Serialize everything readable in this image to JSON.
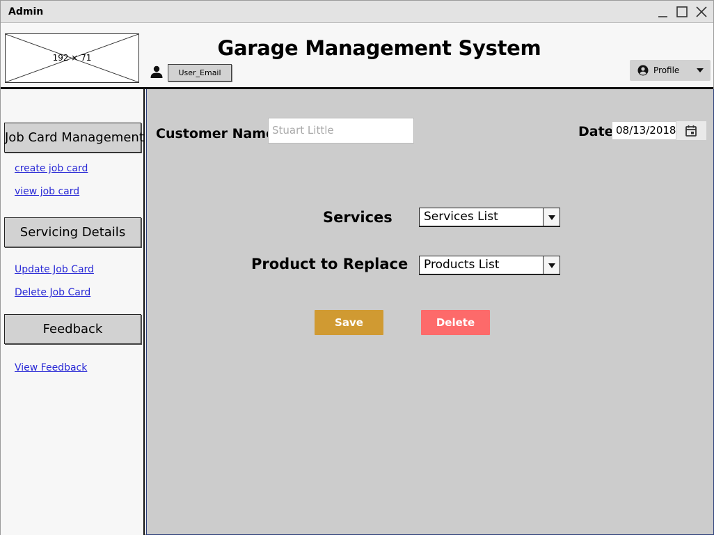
{
  "window": {
    "title": "Admin"
  },
  "header": {
    "logo_placeholder": "192 × 71",
    "app_title": "Garage Management System",
    "user_email": "User_Email",
    "profile_label": "Profile"
  },
  "sidebar": {
    "sections": [
      {
        "label": "Job Card Management",
        "links": [
          "create job card",
          "view job card"
        ]
      },
      {
        "label": "Servicing Details",
        "links": [
          "Update Job Card",
          "Delete Job Card"
        ]
      },
      {
        "label": "Feedback",
        "links": [
          "View Feedback"
        ]
      }
    ]
  },
  "form": {
    "customer_name_label": "Customer Name",
    "customer_name_placeholder": "Stuart Little",
    "date_label": "Date",
    "date_value": "08/13/2018",
    "services_label": "Services",
    "services_select": "Services List",
    "product_label": "Product to Replace",
    "product_select": "Products List",
    "save_label": "Save",
    "delete_label": "Delete"
  },
  "colors": {
    "save_button": "#d09a32",
    "delete_button": "#fd6a6a",
    "main_background": "#cccccc",
    "link": "#2a2ad6"
  },
  "icons": {
    "minimize": "minimize-icon",
    "maximize": "maximize-icon",
    "close": "close-icon",
    "user": "person-icon",
    "profile": "account-circle-icon",
    "calendar": "calendar-icon"
  }
}
